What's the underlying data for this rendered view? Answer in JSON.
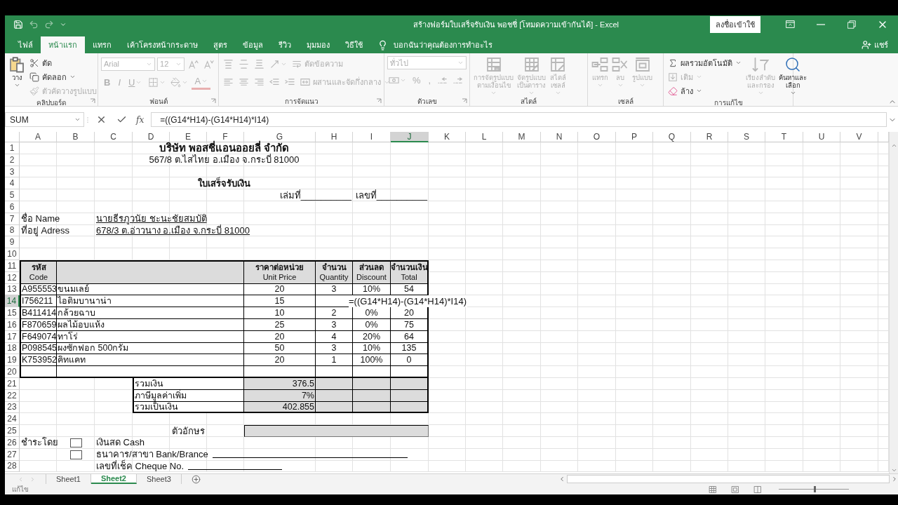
{
  "window": {
    "title": "สร้างฟอร์มใบเสร็จรับเงิน พอชชี่  [โหมดความเข้ากันได้]  -  Excel",
    "sign_in": "ลงชื่อเข้าใช้"
  },
  "menu_tabs": [
    {
      "label": "ไฟล์",
      "selected": false
    },
    {
      "label": "หน้าแรก",
      "selected": true
    },
    {
      "label": "แทรก",
      "selected": false
    },
    {
      "label": "เค้าโครงหน้ากระดาษ",
      "selected": false
    },
    {
      "label": "สูตร",
      "selected": false
    },
    {
      "label": "ข้อมูล",
      "selected": false
    },
    {
      "label": "รีวิว",
      "selected": false
    },
    {
      "label": "มุมมอง",
      "selected": false
    },
    {
      "label": "วิธีใช้",
      "selected": false
    }
  ],
  "tell_me": "บอกฉันว่าคุณต้องการทำอะไร",
  "share": "แชร์",
  "ribbon": [
    {
      "label": "คลิปบอร์ด",
      "columns": [
        [
          {
            "kind": "large",
            "label": "วาง",
            "dropdown": true,
            "disabled": false
          }
        ],
        [
          {
            "kind": "small",
            "label": "ตัด",
            "dropdown": false,
            "disabled": false
          },
          {
            "kind": "small",
            "label": "คัดลอก",
            "dropdown": true,
            "disabled": false
          },
          {
            "kind": "small",
            "label": "ตัวคัดวางรูปแบบ",
            "dropdown": false,
            "disabled": true
          }
        ]
      ]
    },
    {
      "label": "ฟอนต์",
      "rows": [
        [
          {
            "kind": "field",
            "value": "Arial",
            "disabled": true
          },
          {
            "kind": "field",
            "value": "12",
            "disabled": true
          },
          {
            "kind": "icon",
            "dropdown": false,
            "disabled": true
          },
          {
            "kind": "icon",
            "dropdown": false,
            "disabled": true
          }
        ],
        [
          {
            "kind": "glyph",
            "label": "B",
            "dropdown": false,
            "disabled": true
          },
          {
            "kind": "glyph",
            "label": "I",
            "dropdown": false,
            "disabled": true
          },
          {
            "kind": "glyph",
            "label": "U",
            "dropdown": true,
            "disabled": true
          },
          {
            "kind": "icon",
            "dropdown": true,
            "disabled": true
          },
          {
            "kind": "icon",
            "dropdown": true,
            "disabled": true
          },
          {
            "kind": "glyph",
            "label": "A",
            "dropdown": true,
            "disabled": true
          }
        ]
      ]
    },
    {
      "label": "การจัดแนว",
      "rows": [
        [
          {
            "kind": "icon",
            "dropdown": false,
            "disabled": true
          },
          {
            "kind": "icon",
            "dropdown": false,
            "disabled": true
          },
          {
            "kind": "icon",
            "dropdown": false,
            "disabled": true
          },
          {
            "kind": "icon",
            "dropdown": true,
            "disabled": true
          },
          {
            "kind": "small",
            "label": "ตัดข้อความ",
            "dropdown": false,
            "disabled": true
          }
        ],
        [
          {
            "kind": "icon",
            "dropdown": false,
            "disabled": true
          },
          {
            "kind": "icon",
            "dropdown": false,
            "disabled": true
          },
          {
            "kind": "icon",
            "dropdown": false,
            "disabled": true
          },
          {
            "kind": "icon",
            "dropdown": false,
            "disabled": true
          },
          {
            "kind": "icon",
            "dropdown": false,
            "disabled": true
          },
          {
            "kind": "small",
            "label": "ผสานและจัดกึ่งกลาง",
            "dropdown": true,
            "disabled": true
          }
        ]
      ]
    },
    {
      "label": "ตัวเลข",
      "rows": [
        [
          {
            "kind": "field",
            "value": "ทั่วไป",
            "disabled": true
          }
        ],
        [
          {
            "kind": "icon",
            "dropdown": true,
            "disabled": true
          },
          {
            "kind": "glyph",
            "label": "%",
            "dropdown": false,
            "disabled": true
          },
          {
            "kind": "glyph",
            "label": ",",
            "dropdown": false,
            "disabled": true
          },
          {
            "kind": "icon",
            "dropdown": false,
            "disabled": true
          },
          {
            "kind": "icon",
            "dropdown": false,
            "disabled": true
          }
        ]
      ]
    },
    {
      "label": "สไตล์",
      "columns": [
        [
          {
            "kind": "large",
            "label": "การจัดรูปแบบ\nตามเงื่อนไข",
            "dropdown": true,
            "disabled": true
          }
        ],
        [
          {
            "kind": "large",
            "label": "จัดรูปแบบ\nเป็นตาราง",
            "dropdown": true,
            "disabled": true
          }
        ],
        [
          {
            "kind": "large",
            "label": "สไตล์\nเซลล์",
            "dropdown": true,
            "disabled": true
          }
        ]
      ]
    },
    {
      "label": "เซลล์",
      "columns": [
        [
          {
            "kind": "large",
            "label": "แทรก",
            "dropdown": true,
            "disabled": true
          }
        ],
        [
          {
            "kind": "large",
            "label": "ลบ",
            "dropdown": true,
            "disabled": true
          }
        ],
        [
          {
            "kind": "large",
            "label": "รูปแบบ",
            "dropdown": true,
            "disabled": true
          }
        ]
      ]
    },
    {
      "label": "การแก้ไข",
      "columns": [
        [
          {
            "kind": "small",
            "label": "ผลรวมอัตโนมัติ",
            "dropdown": true,
            "disabled": false
          },
          {
            "kind": "small",
            "label": "เติม",
            "dropdown": true,
            "disabled": true
          },
          {
            "kind": "small",
            "label": "ล้าง",
            "dropdown": true,
            "disabled": false
          }
        ],
        [
          {
            "kind": "large",
            "label": "เรียงลำดับ\nและกรอง",
            "dropdown": true,
            "disabled": true
          }
        ],
        [
          {
            "kind": "large",
            "label": "ค้นหาและ\nเลือก",
            "dropdown": true,
            "disabled": false
          }
        ]
      ]
    }
  ],
  "formula_bar": {
    "name_box": "SUM",
    "function_label": "fx",
    "formula": "=((G14*H14)-(G14*H14)*I14)"
  },
  "sheet": {
    "columns": [
      {
        "label": "A",
        "selected": false
      },
      {
        "label": "B",
        "selected": false
      },
      {
        "label": "C",
        "selected": false
      },
      {
        "label": "D",
        "selected": false
      },
      {
        "label": "E",
        "selected": false
      },
      {
        "label": "F",
        "selected": false
      },
      {
        "label": "G",
        "selected": false
      },
      {
        "label": "H",
        "selected": false
      },
      {
        "label": "I",
        "selected": false
      },
      {
        "label": "J",
        "selected": true
      },
      {
        "label": "K",
        "selected": false
      },
      {
        "label": "L",
        "selected": false
      },
      {
        "label": "M",
        "selected": false
      },
      {
        "label": "N",
        "selected": false
      },
      {
        "label": "O",
        "selected": false
      },
      {
        "label": "P",
        "selected": false
      },
      {
        "label": "Q",
        "selected": false
      },
      {
        "label": "R",
        "selected": false
      },
      {
        "label": "S",
        "selected": false
      },
      {
        "label": "T",
        "selected": false
      },
      {
        "label": "U",
        "selected": false
      },
      {
        "label": "V",
        "selected": false
      }
    ],
    "rows": [
      {
        "label": "1",
        "selected": false
      },
      {
        "label": "2",
        "selected": false
      },
      {
        "label": "3",
        "selected": false
      },
      {
        "label": "4",
        "selected": false
      },
      {
        "label": "5",
        "selected": false
      },
      {
        "label": "6",
        "selected": false
      },
      {
        "label": "7",
        "selected": false
      },
      {
        "label": "8",
        "selected": false
      },
      {
        "label": "9",
        "selected": false
      },
      {
        "label": "10",
        "selected": false
      },
      {
        "label": "11",
        "selected": false
      },
      {
        "label": "12",
        "selected": false
      },
      {
        "label": "13",
        "selected": false
      },
      {
        "label": "14",
        "selected": true
      },
      {
        "label": "15",
        "selected": false
      },
      {
        "label": "16",
        "selected": false
      },
      {
        "label": "17",
        "selected": false
      },
      {
        "label": "18",
        "selected": false
      },
      {
        "label": "19",
        "selected": false
      },
      {
        "label": "20",
        "selected": false
      },
      {
        "label": "21",
        "selected": false
      },
      {
        "label": "22",
        "selected": false
      },
      {
        "label": "23",
        "selected": false
      },
      {
        "label": "24",
        "selected": false
      },
      {
        "label": "25",
        "selected": false
      },
      {
        "label": "26",
        "selected": false
      },
      {
        "label": "27",
        "selected": false
      },
      {
        "label": "28",
        "selected": false
      }
    ],
    "company": {
      "name": "บริษัท พอสชี่แอนออยลี่  จำกัด",
      "address": "567/8   ต.ไสไทย   อ.เมือง   จ.กระบี่   81000"
    },
    "receipt_title": "ใบเสร็จรับเงิน",
    "book_number": "เล่มที่__________",
    "receipt_number": "เลขที่__________",
    "customer": [
      {
        "label": "ชื่อ Name",
        "value": "นายธีรภูวนัย ชะนะชัยสมบัติ"
      },
      {
        "label": "ที่อยู่ Adress",
        "value": "678/3 ต.อ่าวนาง อ.เมือง จ.กระบี่ 81000"
      }
    ],
    "table": {
      "headers": [
        {
          "text": "รหัส",
          "subtext": "Code"
        },
        {
          "text": "ราคาต่อหน่วย",
          "subtext": "Unit Price"
        },
        {
          "text": "จำนวน",
          "subtext": "Quantity"
        },
        {
          "text": "ส่วนลด",
          "subtext": "Discount"
        },
        {
          "text": "จำนวนเงิน",
          "subtext": "Total"
        }
      ],
      "items": [
        {
          "code": "A955553",
          "name": "ขนมเลย์",
          "price": "20",
          "quantity": "3",
          "discount": "10%",
          "total": "54"
        },
        {
          "code": "I756211",
          "name": "ไอติมบานาน่า",
          "price": "15",
          "formula": "=((G14*H14)-(G14*H14)*I14)"
        },
        {
          "code": "B411414",
          "name": "กล้วยฉาบ",
          "price": "10",
          "quantity": "2",
          "discount": "0%",
          "total": "20"
        },
        {
          "code": "F870659",
          "name": "ผลไม้อบแห้ง",
          "price": "25",
          "quantity": "3",
          "discount": "0%",
          "total": "75"
        },
        {
          "code": "F649074",
          "name": "ทาโร่",
          "price": "20",
          "quantity": "4",
          "discount": "20%",
          "total": "64"
        },
        {
          "code": "P098545",
          "name": "ผงซักฟอก 500กรัม",
          "price": "50",
          "quantity": "3",
          "discount": "10%",
          "total": "135"
        },
        {
          "code": "K753952",
          "name": "คิทแคท",
          "price": "20",
          "quantity": "1",
          "discount": "100%",
          "total": "0"
        }
      ]
    },
    "summary": [
      {
        "label": "รวมเงิน",
        "value": "376.5"
      },
      {
        "label": "ภาษีมูลค่าเพิ่ม",
        "value": "7%"
      },
      {
        "label": "รวมเป็นเงิน",
        "value": "402.855"
      }
    ],
    "amount_in_words": "ตัวอักษร",
    "payment": {
      "label": "ชำระโดย",
      "options": [
        {
          "kind": "choice",
          "label": "เงินสด Cash",
          "checked": false
        },
        {
          "kind": "blank",
          "label": "ธนาคาร/สาขา Bank/Brance",
          "checked": false
        }
      ],
      "cheque": "เลขที่เช็ค Cheque No."
    }
  },
  "sheet_tabs": [
    {
      "label": "Sheet1",
      "selected": false
    },
    {
      "label": "Sheet2",
      "selected": true
    },
    {
      "label": "Sheet3",
      "selected": false
    }
  ],
  "status_bar": {
    "mode": "แก้ไข",
    "zoom": {
      "level": 0.5
    }
  }
}
